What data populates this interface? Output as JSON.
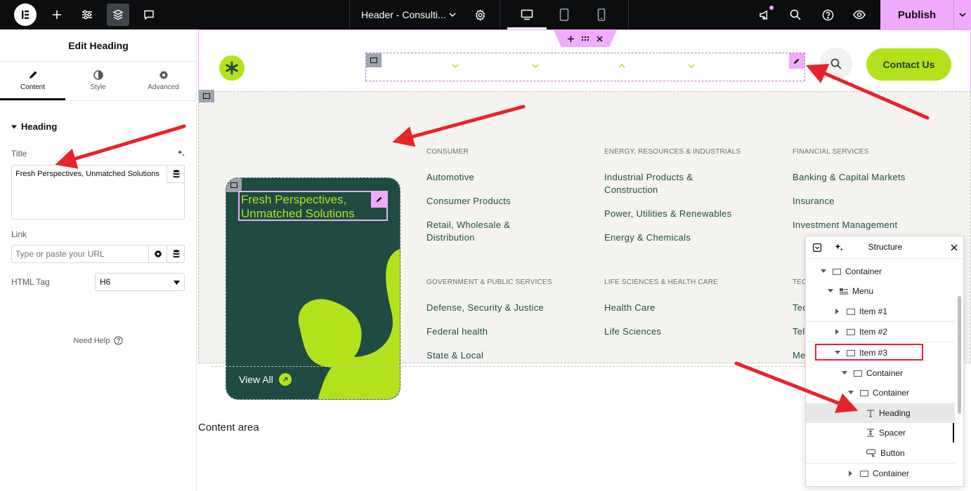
{
  "topbar": {
    "doc_title": "Header - Consulti...",
    "publish_label": "Publish",
    "icons": [
      "elementor-logo-icon",
      "plus-icon",
      "sliders-icon",
      "layers-icon",
      "chat-icon",
      "chevron-down-icon",
      "gear-icon",
      "desktop-icon",
      "tablet-icon",
      "mobile-icon",
      "megaphone-icon",
      "search-icon",
      "help-icon",
      "eye-icon",
      "chevron-down-icon"
    ],
    "accent": "#f0abfc"
  },
  "panel": {
    "title": "Edit Heading",
    "tabs": [
      {
        "label": "Content",
        "icon": "pencil-icon"
      },
      {
        "label": "Style",
        "icon": "half-circle-icon"
      },
      {
        "label": "Advanced",
        "icon": "gear-icon"
      }
    ],
    "section": "Heading",
    "title_label": "Title",
    "title_value": "Fresh Perspectives, Unmatched Solutions",
    "link_label": "Link",
    "link_placeholder": "Type or paste your URL",
    "html_tag_label": "HTML Tag",
    "html_tag_value": "H6",
    "need_help": "Need Help"
  },
  "canvas": {
    "contact_label": "Contact Us",
    "brand_color": "#b3e21c",
    "promo": {
      "heading": "Fresh Perspectives, Unmatched Solutions",
      "view_all": "View All"
    },
    "columns": [
      {
        "title": "CONSUMER",
        "links": [
          "Automotive",
          "Consumer Products",
          "Retail, Wholesale & Distribution"
        ]
      },
      {
        "title": "ENERGY, RESOURCES & INDUSTRIALS",
        "links": [
          "Industrial Products & Construction",
          "Power, Utilities & Renewables",
          "Energy & Chemicals"
        ]
      },
      {
        "title": "FINANCIAL SERVICES",
        "links": [
          "Banking & Capital Markets",
          "Insurance",
          "Investment Management"
        ]
      },
      {
        "title": "GOVERNMENT & PUBLIC SERVICES",
        "links": [
          "Defense, Security & Justice",
          "Federal health",
          "State & Local"
        ]
      },
      {
        "title": "LIFE SCIENCES & HEALTH CARE",
        "links": [
          "Health Care",
          "Life Sciences"
        ]
      },
      {
        "title": "TEC",
        "links": [
          "Tec",
          "Tel",
          "Me"
        ]
      }
    ],
    "content_area": "Content area"
  },
  "structure": {
    "title": "Structure",
    "rows": [
      {
        "label": "Container",
        "icon": "container-icon",
        "caret": "down"
      },
      {
        "label": "Menu",
        "icon": "menu-icon",
        "caret": "down"
      },
      {
        "label": "Item #1",
        "icon": "container-icon",
        "caret": "right"
      },
      {
        "label": "Item #2",
        "icon": "container-icon",
        "caret": "right"
      },
      {
        "label": "Item #3",
        "icon": "container-icon",
        "caret": "down"
      },
      {
        "label": "Container",
        "icon": "container-icon",
        "caret": "down"
      },
      {
        "label": "Container",
        "icon": "container-icon",
        "caret": "down"
      },
      {
        "label": "Heading",
        "icon": "heading-icon",
        "caret": ""
      },
      {
        "label": "Spacer",
        "icon": "spacer-icon",
        "caret": ""
      },
      {
        "label": "Button",
        "icon": "button-icon",
        "caret": ""
      },
      {
        "label": "Container",
        "icon": "container-icon",
        "caret": "right"
      }
    ]
  },
  "annotations": {
    "arrow_color": "#e8232a"
  }
}
